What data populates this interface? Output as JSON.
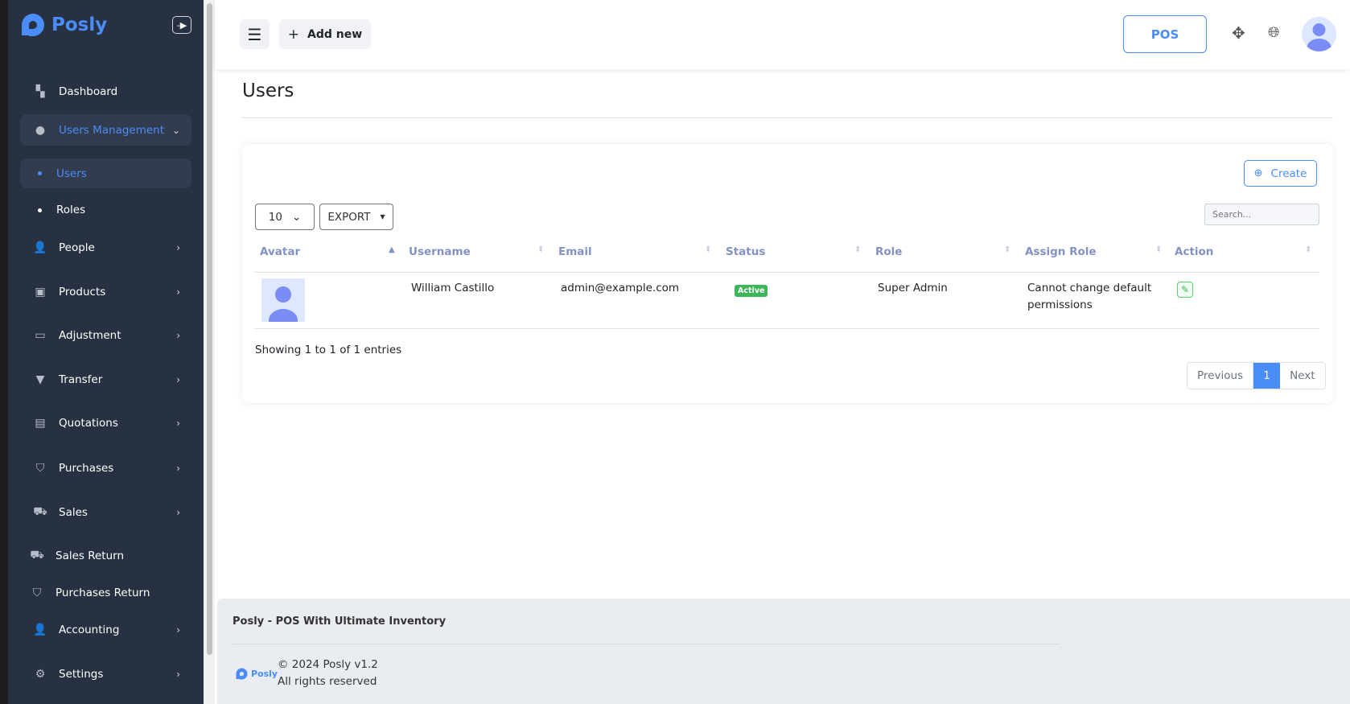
{
  "brand": {
    "name": "Posly",
    "color": "#4a8df8"
  },
  "sidebar": {
    "items": [
      {
        "label": "Dashboard",
        "icon": "dashboard-icon"
      },
      {
        "label": "Users Management",
        "icon": "user-icon",
        "expanded": true
      },
      {
        "label": "Users",
        "sub": true,
        "active": true
      },
      {
        "label": "Roles",
        "sub": true
      },
      {
        "label": "People",
        "icon": "people-icon"
      },
      {
        "label": "Products",
        "icon": "products-icon"
      },
      {
        "label": "Adjustment",
        "icon": "adjustment-icon"
      },
      {
        "label": "Transfer",
        "icon": "transfer-icon"
      },
      {
        "label": "Quotations",
        "icon": "clipboard-icon"
      },
      {
        "label": "Purchases",
        "icon": "bag-icon"
      },
      {
        "label": "Sales",
        "icon": "cart-icon"
      },
      {
        "label": "Sales Return",
        "icon": "cart-return-icon"
      },
      {
        "label": "Purchases Return",
        "icon": "bag-return-icon"
      },
      {
        "label": "Accounting",
        "icon": "accounting-icon"
      },
      {
        "label": "Settings",
        "icon": "gear-icon"
      }
    ]
  },
  "header": {
    "add_new": "Add new",
    "pos": "POS"
  },
  "page": {
    "title": "Users"
  },
  "table": {
    "create": "Create",
    "page_size": "10",
    "export": "EXPORT",
    "search_placeholder": "Search...",
    "columns": [
      "Avatar",
      "Username",
      "Email",
      "Status",
      "Role",
      "Assign Role",
      "Action"
    ],
    "rows": [
      {
        "username": "William Castillo",
        "email": "admin@example.com",
        "status": "Active",
        "role": "Super Admin",
        "assign_role": "Cannot change default permissions"
      }
    ],
    "showing": "Showing 1 to 1 of 1 entries",
    "pagination": {
      "previous": "Previous",
      "current": "1",
      "next": "Next"
    }
  },
  "footer": {
    "title": "Posly - POS With Ultimate Inventory",
    "copyright": "© 2024 Posly v1.2",
    "rights": "All rights reserved",
    "logo_text": "Posly"
  }
}
